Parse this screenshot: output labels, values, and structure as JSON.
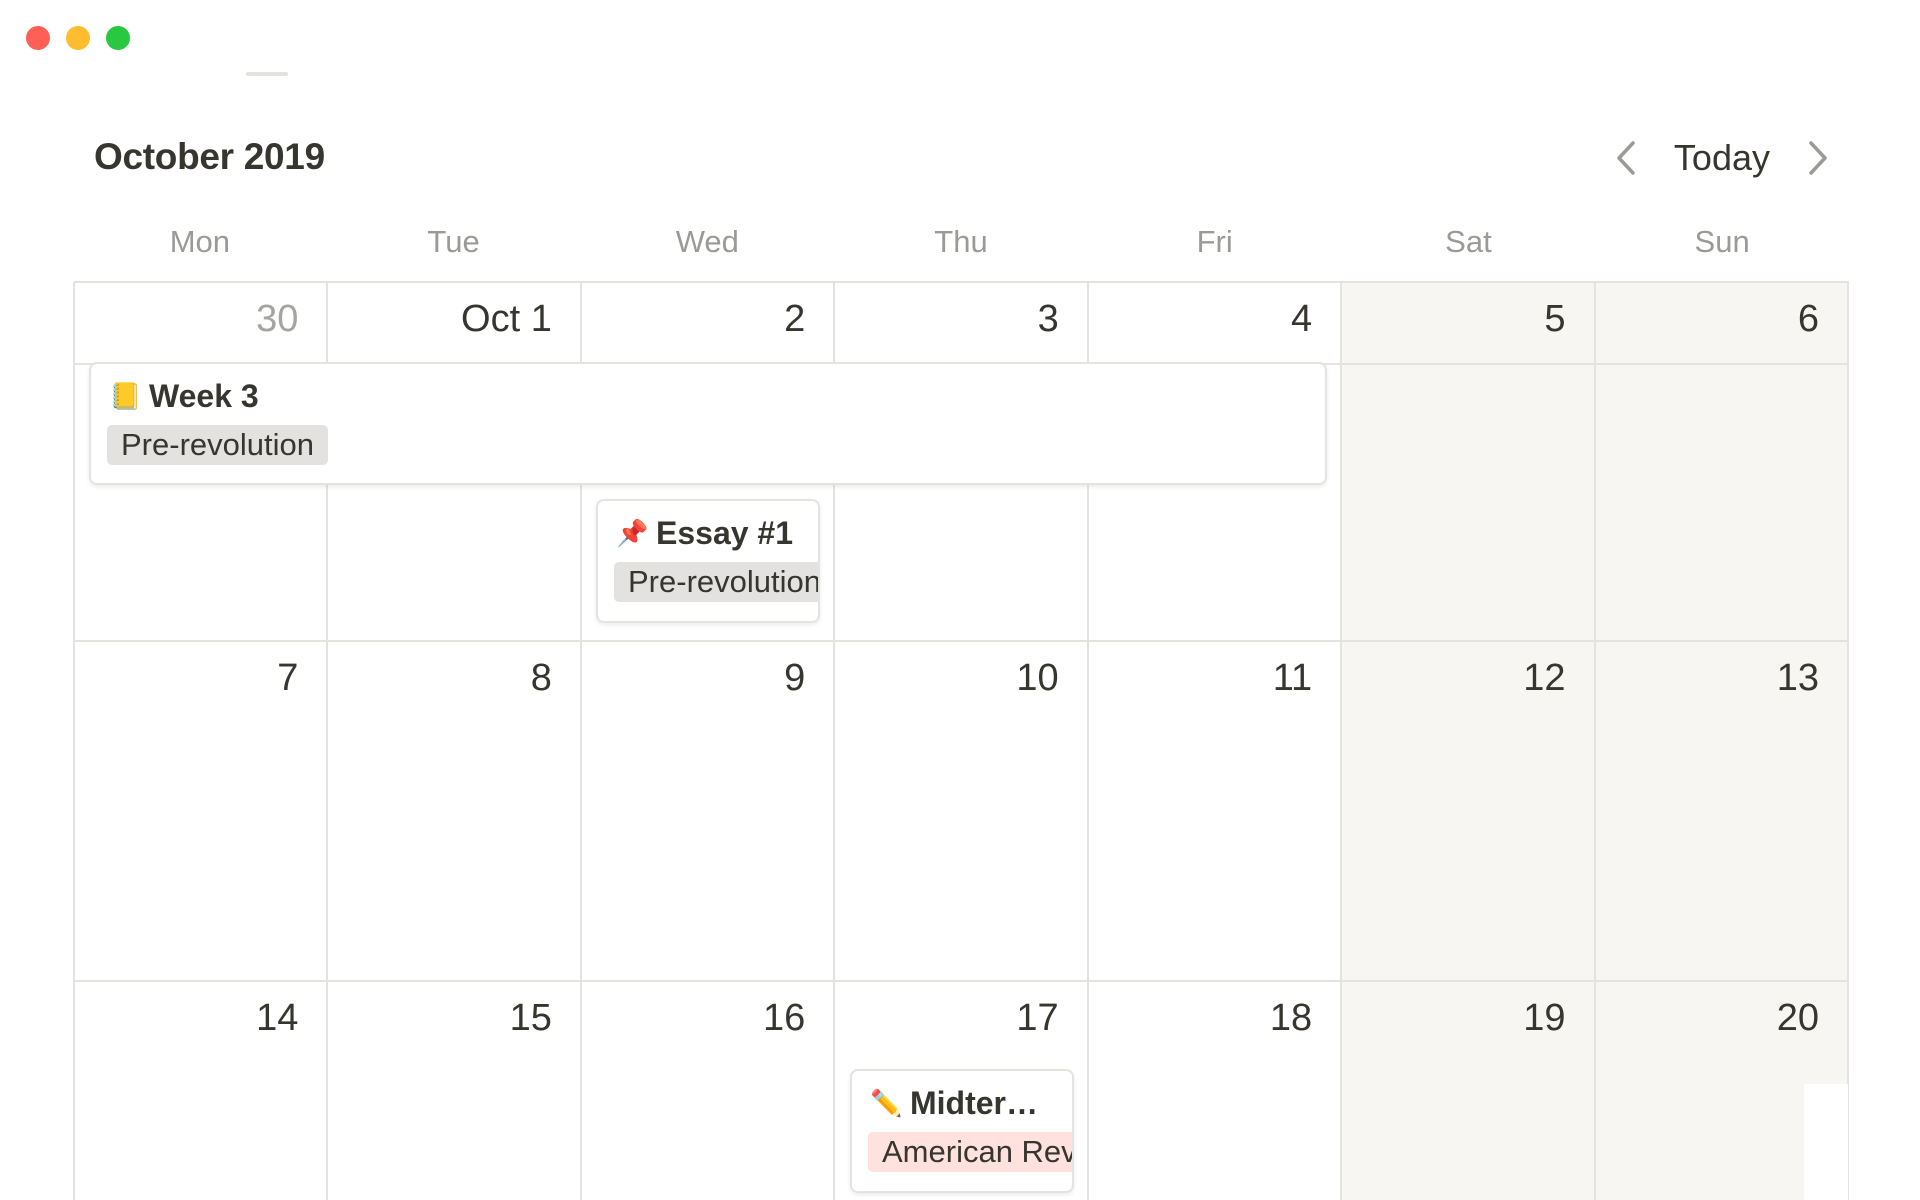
{
  "header": {
    "title": "October 2019",
    "today_label": "Today"
  },
  "weekdays": [
    "Mon",
    "Tue",
    "Wed",
    "Thu",
    "Fri",
    "Sat",
    "Sun"
  ],
  "weeks": [
    [
      "30",
      "Oct 1",
      "2",
      "3",
      "4",
      "5",
      "6"
    ],
    [
      "7",
      "8",
      "9",
      "10",
      "11",
      "12",
      "13"
    ],
    [
      "14",
      "15",
      "16",
      "17",
      "18",
      "19",
      "20"
    ]
  ],
  "events": [
    {
      "title": "Week 3",
      "icon": "notebook-icon",
      "tag": "Pre-revolution",
      "tag_color": "#e3e2e0"
    },
    {
      "title": "Essay #1",
      "icon": "pushpin-icon",
      "tag": "Pre-revolution",
      "tag_color": "#e3e2e0"
    },
    {
      "title": "Midter…",
      "icon": "pencil-icon",
      "tag": "American Rev",
      "tag_color": "#ffe2dd"
    }
  ],
  "colors": {
    "text": "#37352f",
    "muted": "#9b9a97",
    "weekend_bg": "#f7f6f3",
    "grid_line": "#e4e3e0"
  }
}
